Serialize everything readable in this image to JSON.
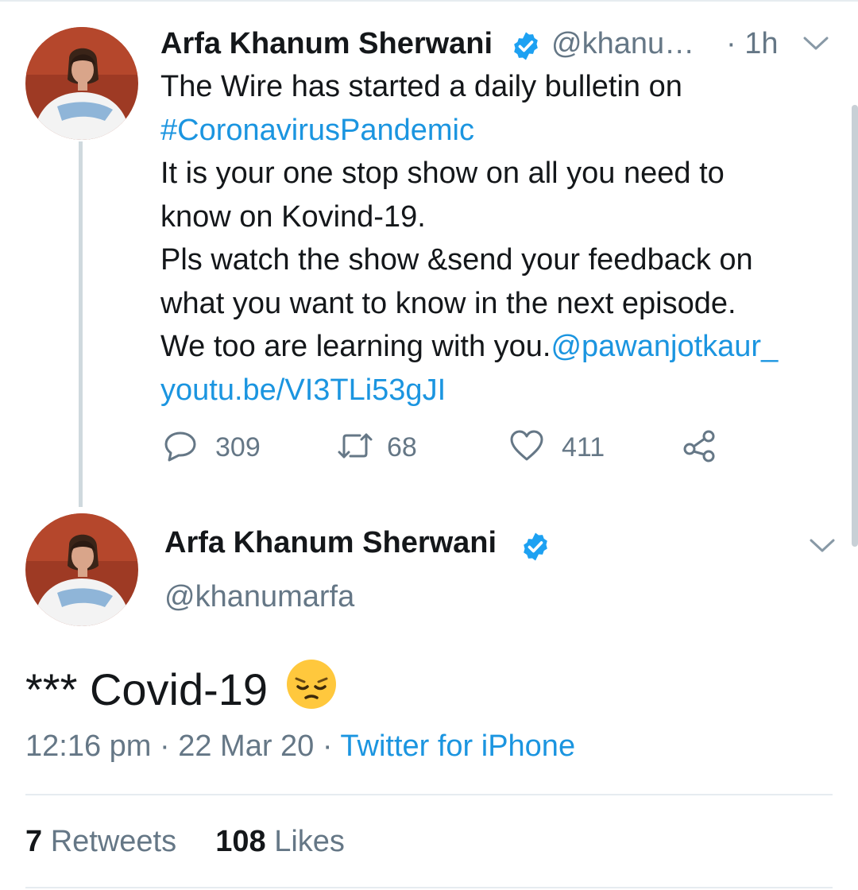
{
  "thread_tweet": {
    "author_name": "Arfa Khanum Sherwani",
    "author_handle": "@khanu…",
    "time": "· 1h",
    "lines": [
      {
        "text": "The Wire has started a daily bulletin on",
        "link": ""
      },
      {
        "text": "",
        "link": "#CoronavirusPandemic"
      },
      {
        "text": "It is your one stop show on all you need to",
        "link": ""
      },
      {
        "text": "know on Kovind-19.",
        "link": ""
      },
      {
        "text": "Pls watch the show &send your feedback on",
        "link": ""
      },
      {
        "text": "what you want to know in the next episode.",
        "link": ""
      },
      {
        "text": "We too are learning with you.",
        "link": "@pawanjotkaur_"
      },
      {
        "text": "",
        "link": "youtu.be/VI3TLi53gJI"
      }
    ],
    "reply_count": "309",
    "retweet_count": "68",
    "like_count": "411",
    "icons": {
      "reply": "reply-icon",
      "retweet": "retweet-icon",
      "like": "heart-icon",
      "share": "share-icon",
      "more": "chevron-down-icon",
      "verified": "verified-badge-icon"
    }
  },
  "main_tweet": {
    "author_name": "Arfa Khanum Sherwani",
    "author_handle": "@khanumarfa",
    "text": "*** Covid-19",
    "emoji": "pensive-face-emoji",
    "timestamp": "12:16 pm · 22 Mar 20 · ",
    "source": "Twitter for iPhone",
    "retweets_count": "7",
    "retweets_label": "Retweets",
    "likes_count": "108",
    "likes_label": "Likes"
  },
  "colors": {
    "link": "#1b95e0",
    "text": "#14171a",
    "secondary": "#657786",
    "verified": "#1da1f2",
    "divider": "#e6ecf0"
  }
}
